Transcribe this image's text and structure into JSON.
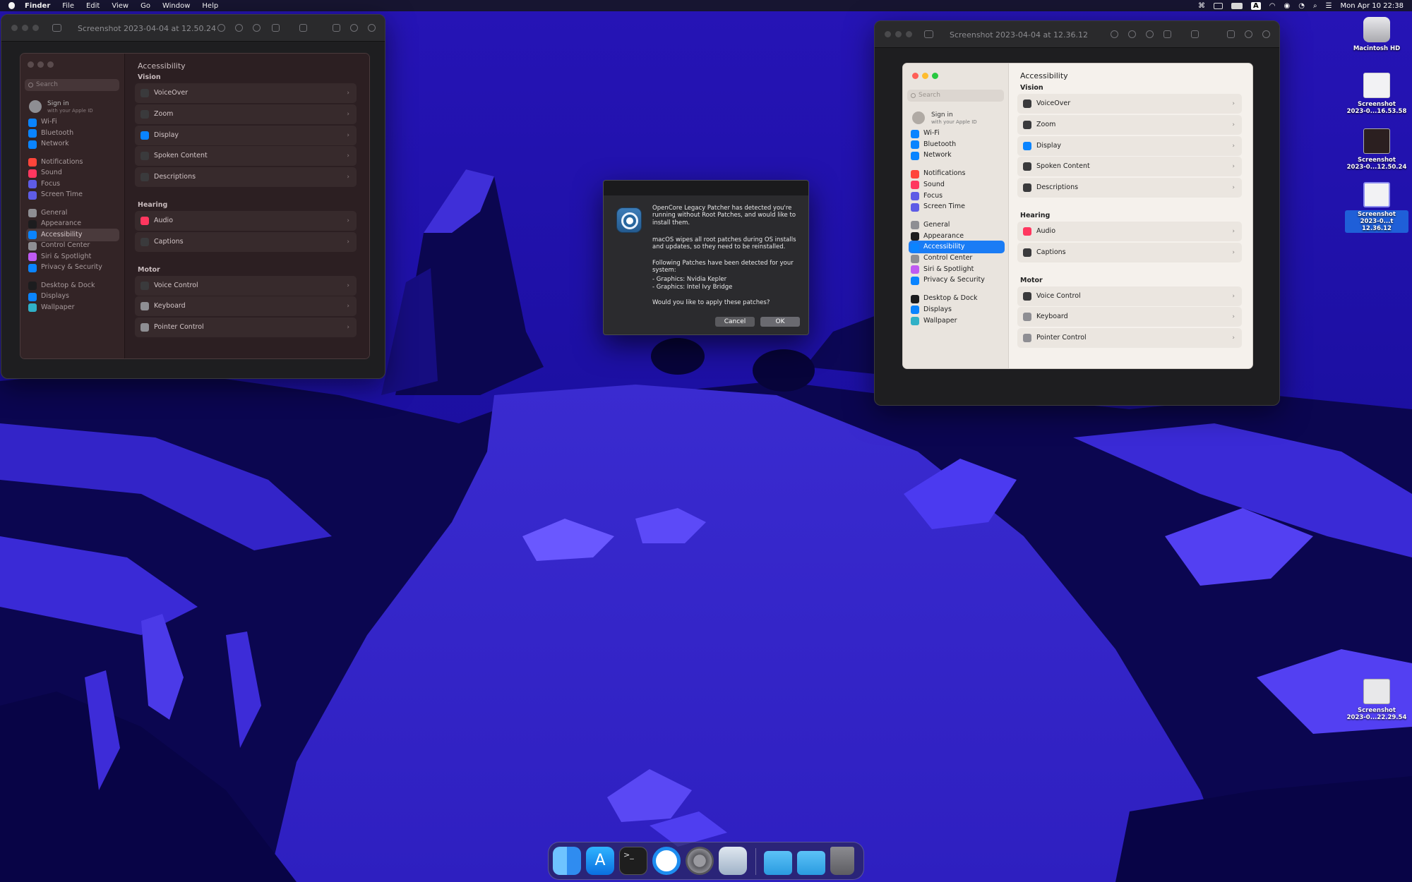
{
  "menubar": {
    "apple": "",
    "items": [
      "Finder",
      "File",
      "Edit",
      "View",
      "Go",
      "Window",
      "Help"
    ],
    "clock": "Mon Apr 10  22:38",
    "input_source": "A"
  },
  "colors": {
    "accent": "#0a84ff",
    "sidebar_selected_dark": "#3a3a3c",
    "dialog_ok": "#636366",
    "wallpaper_base": "#1a0f8f"
  },
  "left_window": {
    "title": "Screenshot 2023-04-04 at 12.50.24",
    "settings": {
      "search_placeholder": "Search",
      "sign_in": "Sign in",
      "sign_in_sub": "with your Apple ID",
      "page_title": "Accessibility",
      "sidebar": [
        {
          "label": "Wi-Fi",
          "icon": "wifi-icon",
          "color": "#0a84ff"
        },
        {
          "label": "Bluetooth",
          "icon": "bluetooth-icon",
          "color": "#0a84ff"
        },
        {
          "label": "Network",
          "icon": "globe-icon",
          "color": "#0a84ff"
        },
        {
          "label": "Notifications",
          "icon": "bell-icon",
          "color": "#ff453a"
        },
        {
          "label": "Sound",
          "icon": "speaker-icon",
          "color": "#ff375f"
        },
        {
          "label": "Focus",
          "icon": "moon-icon",
          "color": "#5e5ce6"
        },
        {
          "label": "Screen Time",
          "icon": "hourglass-icon",
          "color": "#5e5ce6"
        },
        {
          "label": "General",
          "icon": "gear-icon",
          "color": "#8e8e93"
        },
        {
          "label": "Appearance",
          "icon": "appearance-icon",
          "color": "#1c1c1e"
        },
        {
          "label": "Accessibility",
          "icon": "accessibility-icon",
          "color": "#0a84ff"
        },
        {
          "label": "Control Center",
          "icon": "control-center-icon",
          "color": "#8e8e93"
        },
        {
          "label": "Siri & Spotlight",
          "icon": "siri-icon",
          "color": "#bf5af2"
        },
        {
          "label": "Privacy & Security",
          "icon": "hand-icon",
          "color": "#0a84ff"
        },
        {
          "label": "Desktop & Dock",
          "icon": "dock-icon",
          "color": "#1c1c1e"
        },
        {
          "label": "Displays",
          "icon": "sun-icon",
          "color": "#0a84ff"
        },
        {
          "label": "Wallpaper",
          "icon": "wallpaper-icon",
          "color": "#30b0c7"
        }
      ],
      "sections": [
        {
          "title": "Vision",
          "rows": [
            {
              "label": "VoiceOver",
              "icon": "voiceover-icon",
              "color": "#3a3a3c"
            },
            {
              "label": "Zoom",
              "icon": "zoom-icon",
              "color": "#3a3a3c"
            },
            {
              "label": "Display",
              "icon": "display-icon",
              "color": "#0a84ff"
            },
            {
              "label": "Spoken Content",
              "icon": "speech-bubble-icon",
              "color": "#3a3a3c"
            },
            {
              "label": "Descriptions",
              "icon": "descriptions-icon",
              "color": "#3a3a3c"
            }
          ]
        },
        {
          "title": "Hearing",
          "rows": [
            {
              "label": "Audio",
              "icon": "speaker-icon",
              "color": "#ff375f"
            },
            {
              "label": "Captions",
              "icon": "captions-icon",
              "color": "#3a3a3c"
            }
          ]
        },
        {
          "title": "Motor",
          "rows": [
            {
              "label": "Voice Control",
              "icon": "voice-control-icon",
              "color": "#3a3a3c"
            },
            {
              "label": "Keyboard",
              "icon": "keyboard-icon",
              "color": "#8e8e93"
            },
            {
              "label": "Pointer Control",
              "icon": "pointer-icon",
              "color": "#8e8e93"
            }
          ]
        }
      ]
    }
  },
  "right_window": {
    "title": "Screenshot 2023-04-04 at 12.36.12"
  },
  "dialog": {
    "p1": "OpenCore Legacy Patcher has detected you're running without Root Patches, and would like to install them.",
    "p2": "macOS wipes all root patches during OS installs and updates, so they need to be reinstalled.",
    "p3": "Following Patches have been detected for your system:",
    "patch1": "- Graphics: Nvidia Kepler",
    "patch2": "- Graphics: Intel Ivy Bridge",
    "question": "Would you like to apply these patches?",
    "cancel": "Cancel",
    "ok": "OK"
  },
  "desktop_items": [
    {
      "label": "Macintosh HD",
      "icon": "hard-drive-icon"
    },
    {
      "label": "Screenshot\n2023-0...16.53.58",
      "icon": "screenshot-file-icon"
    },
    {
      "label": "Screenshot\n2023-0...12.50.24",
      "icon": "screenshot-file-icon"
    },
    {
      "label": "Screenshot\n2023-0...t 12.36.12",
      "icon": "screenshot-file-icon",
      "selected": true
    },
    {
      "label": "Screenshot\n2023-0...22.29.54",
      "icon": "screenshot-file-icon"
    }
  ],
  "dock": [
    {
      "name": "Finder",
      "icon": "finder-icon"
    },
    {
      "name": "App Store",
      "icon": "app-store-icon"
    },
    {
      "name": "Terminal",
      "icon": "terminal-icon"
    },
    {
      "name": "Safari",
      "icon": "safari-icon"
    },
    {
      "name": "System Settings",
      "icon": "system-settings-icon"
    },
    {
      "name": "Preview",
      "icon": "preview-icon"
    },
    {
      "name": "Documents",
      "icon": "folder-icon"
    },
    {
      "name": "Downloads",
      "icon": "downloads-folder-icon"
    },
    {
      "name": "Trash",
      "icon": "trash-icon"
    }
  ]
}
